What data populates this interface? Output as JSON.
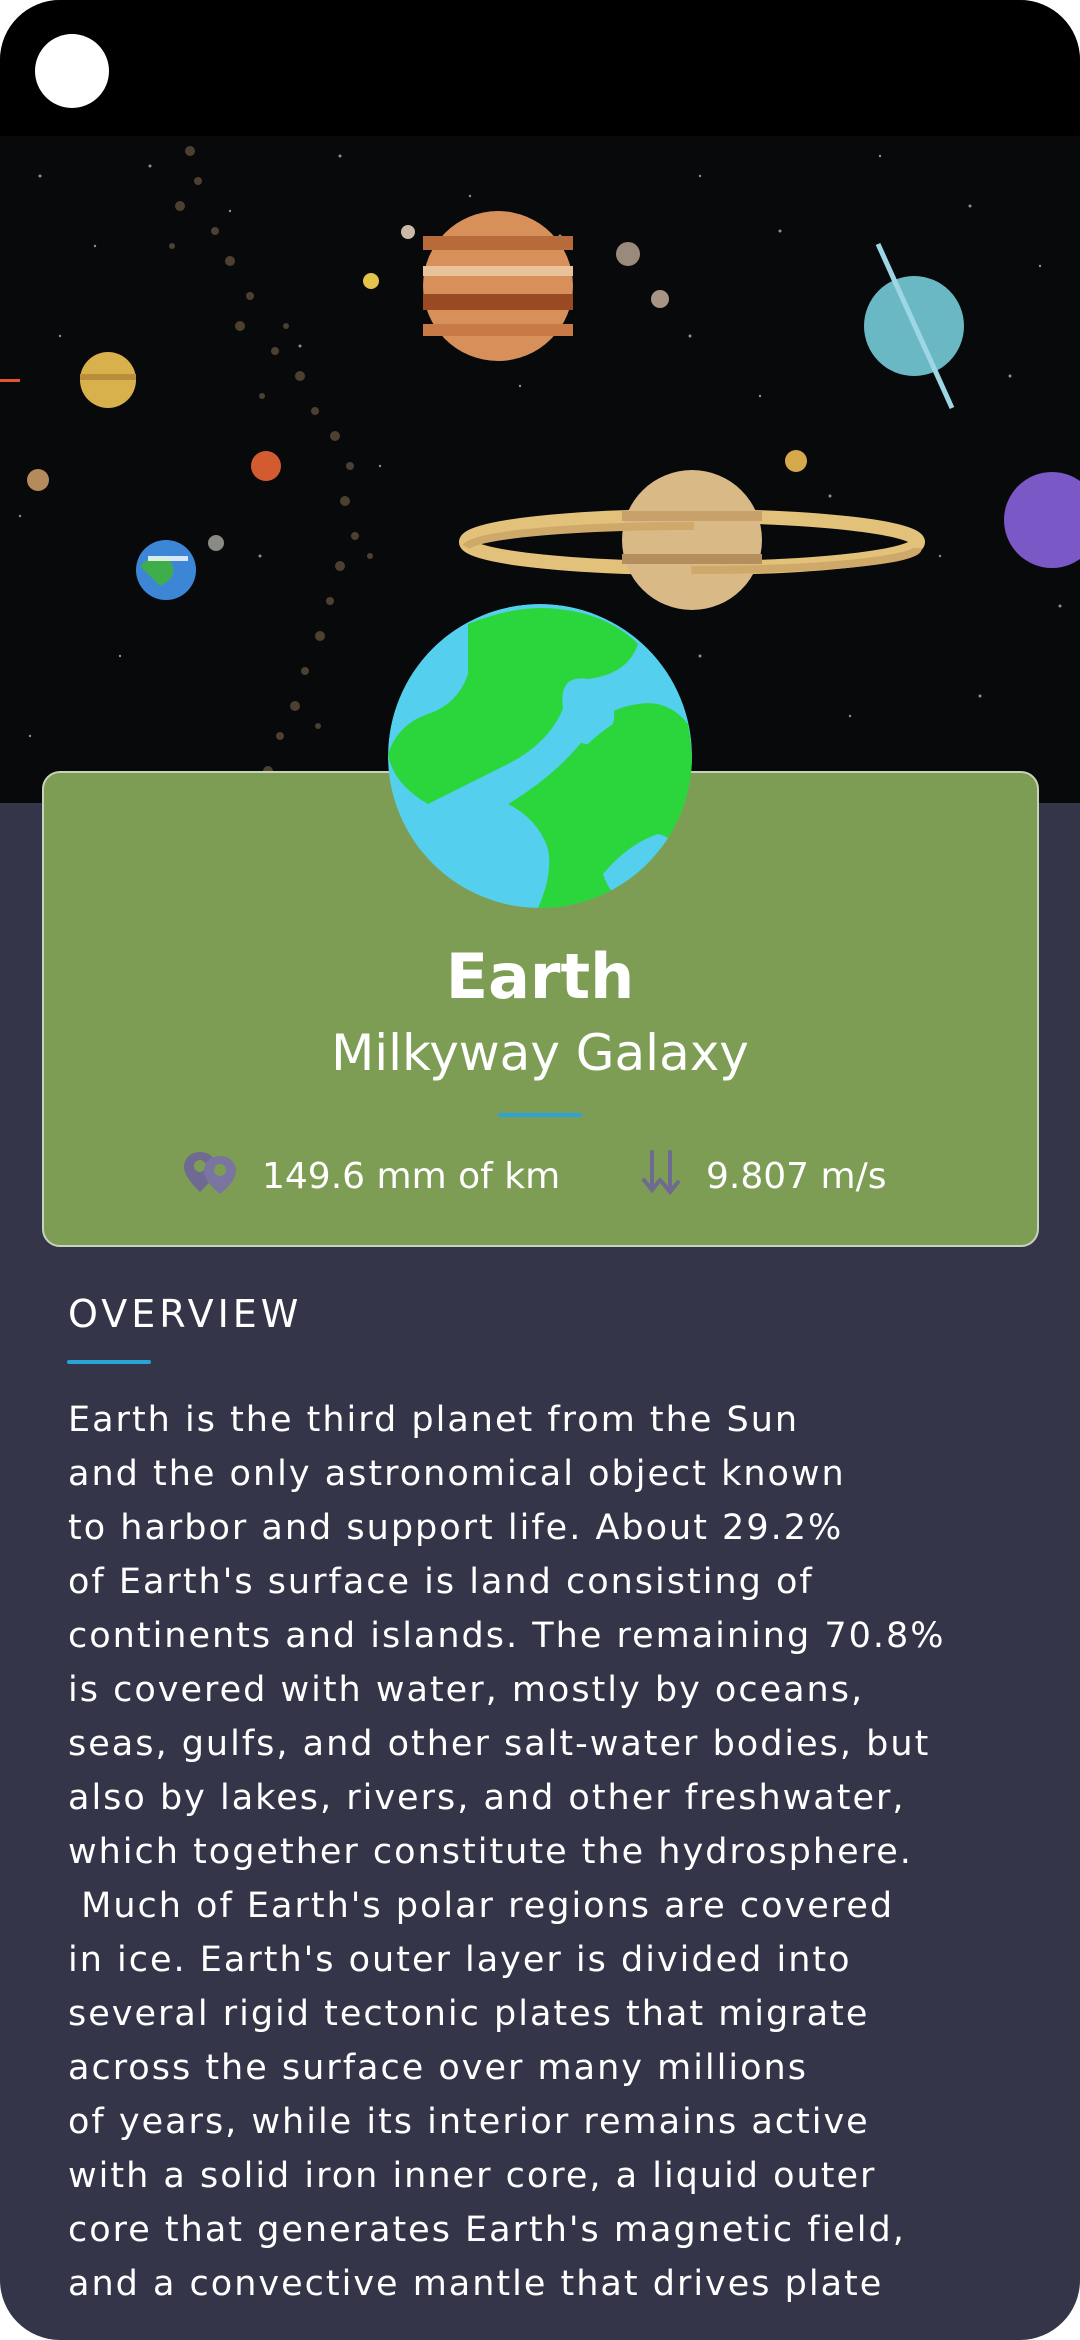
{
  "planet": {
    "name": "Earth",
    "galaxy": "Milkyway Galaxy",
    "distance": "149.6 mm of km",
    "gravity": "9.807 m/s"
  },
  "overview": {
    "heading": "OVERVIEW",
    "lines": [
      "Earth is the third planet from the Sun",
      "and the only astronomical object known",
      "to harbor and support life. About 29.2%",
      "of Earth's surface is land consisting of",
      "continents and islands. The remaining 70.8%",
      "is covered with water, mostly by oceans,",
      "seas, gulfs, and other salt-water bodies, but",
      "also by lakes, rivers, and other freshwater,",
      "which together constitute the hydrosphere.",
      " Much of Earth's polar regions are covered",
      "in ice. Earth's outer layer is divided into",
      "several rigid tectonic plates that migrate",
      "across the surface over many millions",
      "of years, while its interior remains active",
      "with a solid iron inner core, a liquid outer",
      "core that generates Earth's magnetic field,",
      "and a convective mantle that drives plate"
    ]
  },
  "icons": {
    "distance": "location-pins-icon",
    "gravity": "arrows-down-up-icon"
  },
  "colors": {
    "background": "#343548",
    "card": "#7e9d54",
    "accent": "#2aa3d8",
    "earth_land": "#2bd63c",
    "earth_water": "#55cfee"
  }
}
